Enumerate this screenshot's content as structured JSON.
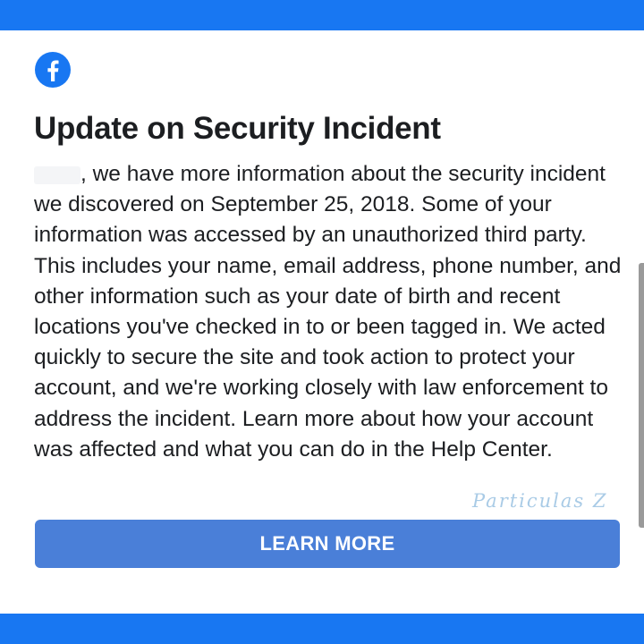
{
  "colors": {
    "brand_blue": "#1877f2",
    "button_blue": "#4a7fd8",
    "text": "#1c1e21",
    "watermark": "#a9cbe6"
  },
  "logo": {
    "icon": "facebook-logo-icon"
  },
  "notice": {
    "title": "Update on Security Incident",
    "body": ", we have more information about the security incident we discovered on September 25, 2018. Some of your information was accessed by an unauthorized third party. This includes your name, email address, phone number, and other information such as your date of birth and recent locations you've checked in to or been tagged in. We acted quickly to secure the site and took action to protect your account, and we're working closely with law enforcement to address the incident. Learn more about how your account was affected and what you can do in the Help Center."
  },
  "watermark": {
    "text": "Particulas Z"
  },
  "actions": {
    "learn_more_label": "LEARN MORE"
  }
}
